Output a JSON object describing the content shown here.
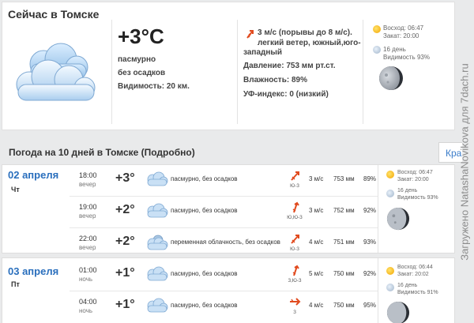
{
  "current": {
    "title": "Сейчас в Томске",
    "temp": "+3°C",
    "condition": "пасмурно",
    "precip": "без осадков",
    "visibility": "Видимость: 20 км.",
    "wind_line1": "3 м/с (порывы до 8 м/с).",
    "wind_line2": "легкий ветер, южный,юго-",
    "wind_line3": "западный",
    "pressure": "Давление: 753 мм рт.ст.",
    "humidity": "Влажность: 89%",
    "uv": "УФ-индекс: 0 (низкий)",
    "sunrise": "Восход: 06:47",
    "sunset": "Закат: 20:00",
    "moon_day": "16 день",
    "moon_visibility": "Видимость 93%"
  },
  "forecast": {
    "title": "Погода на 10 дней в Томске (Подробно)",
    "tab_label": "Кра",
    "days": [
      {
        "date": "02 апреля",
        "dow": "Чт",
        "sunrise": "Восход: 06:47",
        "sunset": "Закат: 20:00",
        "moon_day": "16 день",
        "moon_visibility": "Видимость 93%",
        "rows": [
          {
            "time": "18:00",
            "part": "вечер",
            "temp": "+3°",
            "desc": "пасмурно, без осадков",
            "wind_dir": "Ю-З",
            "speed": "3 м/с",
            "pressure": "753 мм",
            "humidity": "89%"
          },
          {
            "time": "19:00",
            "part": "вечер",
            "temp": "+2°",
            "desc": "пасмурно, без осадков",
            "wind_dir": "Ю,Ю-З",
            "speed": "3 м/с",
            "pressure": "752 мм",
            "humidity": "92%"
          },
          {
            "time": "22:00",
            "part": "вечер",
            "temp": "+2°",
            "desc": "переменная облачность, без осадков",
            "wind_dir": "Ю-З",
            "speed": "4 м/с",
            "pressure": "751 мм",
            "humidity": "93%"
          }
        ]
      },
      {
        "date": "03 апреля",
        "dow": "Пт",
        "sunrise": "Восход: 06:44",
        "sunset": "Закат: 20:02",
        "moon_day": "16 день",
        "moon_visibility": "Видимость 91%",
        "rows": [
          {
            "time": "01:00",
            "part": "ночь",
            "temp": "+1°",
            "desc": "пасмурно, без осадков",
            "wind_dir": "З,Ю-З",
            "speed": "5 м/с",
            "pressure": "750 мм",
            "humidity": "92%"
          },
          {
            "time": "04:00",
            "part": "ночь",
            "temp": "+1°",
            "desc": "пасмурно, без осадков",
            "wind_dir": "З",
            "speed": "4 м/с",
            "pressure": "750 мм",
            "humidity": "95%"
          }
        ]
      }
    ]
  },
  "watermark": "Загружено NatashaNovikova для 7dach.ru",
  "colors": {
    "link_blue": "#2a6fbd",
    "wind_arrow": "#e14b1f",
    "cloud_blue": "#8fbde6",
    "sun": "#f3a400"
  }
}
